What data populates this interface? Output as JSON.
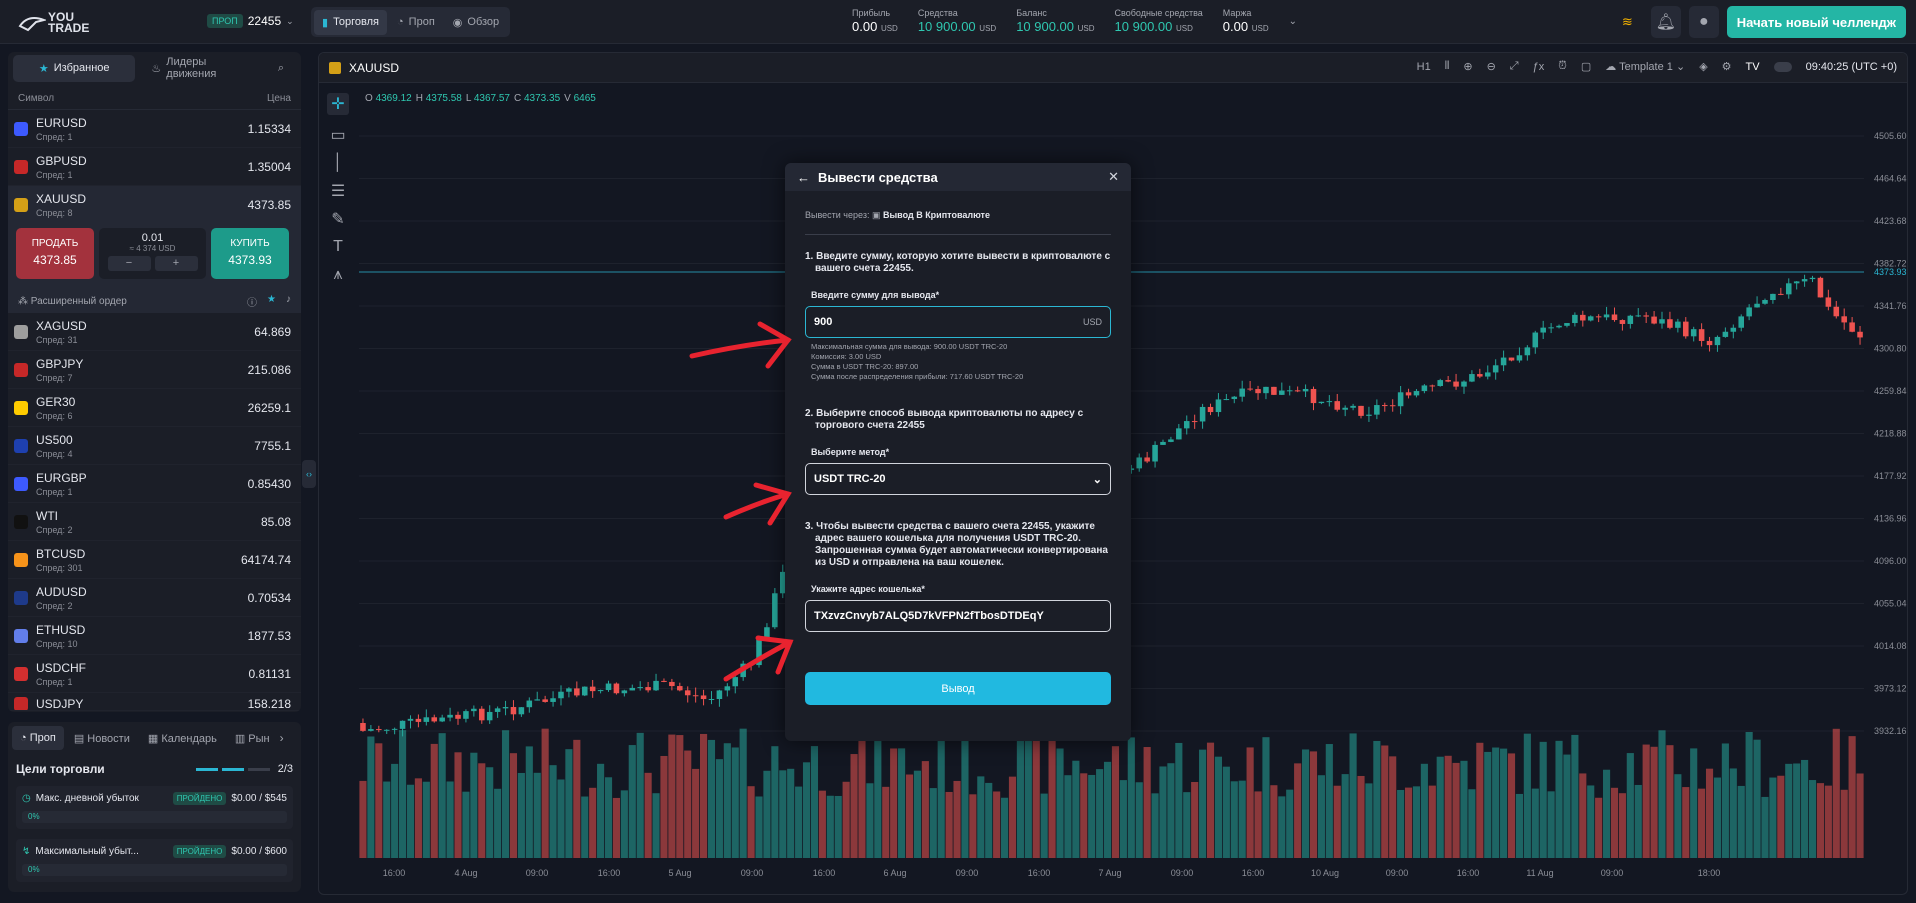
{
  "brand": {
    "line1": "YOU",
    "line2": "TRADE"
  },
  "account": {
    "badge": "ПРОП",
    "number": "22455"
  },
  "nav": [
    {
      "label": "Торговля",
      "active": true
    },
    {
      "label": "Проп"
    },
    {
      "label": "Обзор"
    }
  ],
  "stats": [
    {
      "label": "Прибыль",
      "value": "0.00",
      "unit": "USD"
    },
    {
      "label": "Средства",
      "value": "10 900.00",
      "unit": "USD"
    },
    {
      "label": "Баланс",
      "value": "10 900.00",
      "unit": "USD"
    },
    {
      "label": "Свободные средства",
      "value": "10 900.00",
      "unit": "USD"
    },
    {
      "label": "Маржа",
      "value": "0.00",
      "unit": "USD"
    }
  ],
  "cta": "Начать новый челлендж",
  "watchlist": {
    "tabs": [
      "Избранное",
      "Лидеры движения"
    ],
    "col_symbol": "Символ",
    "col_price": "Цена",
    "rows": [
      {
        "name": "EURUSD",
        "spread": "Спред: 1",
        "price": "1.15334",
        "color": "#3d5afe"
      },
      {
        "name": "GBPUSD",
        "spread": "Спред: 1",
        "price": "1.35004",
        "color": "#c62828"
      },
      {
        "name": "XAUUSD",
        "spread": "Спред: 8",
        "price": "4373.85",
        "color": "#d4a017"
      },
      {
        "name": "XAGUSD",
        "spread": "Спред: 31",
        "price": "64.869",
        "color": "#9e9e9e"
      },
      {
        "name": "GBPJPY",
        "spread": "Спред: 7",
        "price": "215.086",
        "color": "#c62828"
      },
      {
        "name": "GER30",
        "spread": "Спред: 6",
        "price": "26259.1",
        "color": "#ffcc00"
      },
      {
        "name": "US500",
        "spread": "Спред: 4",
        "price": "7755.1",
        "color": "#1e40af"
      },
      {
        "name": "EURGBP",
        "spread": "Спред: 1",
        "price": "0.85430",
        "color": "#3d5afe"
      },
      {
        "name": "WTI",
        "spread": "Спред: 2",
        "price": "85.08",
        "color": "#111111"
      },
      {
        "name": "BTCUSD",
        "spread": "Спред: 301",
        "price": "64174.74",
        "color": "#f7931a"
      },
      {
        "name": "AUDUSD",
        "spread": "Спред: 2",
        "price": "0.70534",
        "color": "#1e3a8a"
      },
      {
        "name": "ETHUSD",
        "spread": "Спред: 10",
        "price": "1877.53",
        "color": "#627eea"
      },
      {
        "name": "USDCHF",
        "spread": "Спред: 1",
        "price": "0.81131",
        "color": "#d32f2f"
      }
    ],
    "partial_row": {
      "name": "USDJPY",
      "price": "158.218"
    },
    "trade": {
      "sell_label": "ПРОДАТЬ",
      "sell_price": "4373.85",
      "lot": "0.01",
      "lot_usd": "≈ 4 374 USD",
      "buy_label": "КУПИТЬ",
      "buy_price": "4373.93"
    },
    "advanced": "Расширенный ордер"
  },
  "bottom": {
    "tabs": [
      "Проп",
      "Новости",
      "Календарь",
      "Рын"
    ],
    "goals_title": "Цели торговли",
    "goals_count": "2/3",
    "goals": [
      {
        "label": "Макс. дневной убыток",
        "status": "ПРОЙДЕНО",
        "value": "$0.00 / $545",
        "pct": "0%"
      },
      {
        "label": "Максимальный убыт...",
        "status": "ПРОЙДЕНО",
        "value": "$0.00 / $600",
        "pct": "0%"
      }
    ]
  },
  "chart": {
    "symbol": "XAUUSD",
    "timeframe": "H1",
    "template": "Template 1",
    "time": "09:40:25 (UTC +0)",
    "ohlc": {
      "o": "4369.12",
      "h": "4375.58",
      "l": "4367.57",
      "c": "4373.35",
      "v": "6465"
    },
    "y_ticks": [
      "4505.60",
      "4464.64",
      "4423.68",
      "4382.72",
      "4341.76",
      "4300.80",
      "4259.84",
      "4218.88",
      "4177.92",
      "4136.96",
      "4096.00",
      "4055.04",
      "4014.08",
      "3973.12",
      "3932.16"
    ],
    "current_price": "4373.93",
    "x_ticks": [
      "16:00",
      "4 Aug",
      "09:00",
      "16:00",
      "5 Aug",
      "09:00",
      "16:00",
      "6 Aug",
      "09:00",
      "16:00",
      "7 Aug",
      "09:00",
      "16:00",
      "10 Aug",
      "09:00",
      "16:00",
      "11 Aug",
      "09:00",
      "18:00"
    ]
  },
  "modal": {
    "title": "Вывести средства",
    "via_label": "Вывести через:",
    "via_value": "Вывод В Криптовалюте",
    "step1": "1. Введите сумму, которую хотите вывести в криптовалюте с вашего счета 22455.",
    "amount_label": "Введите сумму для вывода*",
    "amount_value": "900",
    "amount_unit": "USD",
    "info": [
      "Максимальная сумма для вывода: 900.00 USDT TRC-20",
      "Комиссия: 3.00 USD",
      "Сумма в USDT TRC-20: 897.00",
      "Сумма после распределения прибыли: 717.60 USDT TRC-20"
    ],
    "step2": "2. Выберите способ вывода криптовалюты по адресу с торгового счета 22455",
    "method_label": "Выберите метод*",
    "method_value": "USDT TRC-20",
    "step3": "3. Чтобы вывести средства с вашего счета 22455, укажите адрес вашего кошелька для получения USDT TRC-20. Запрошенная сумма будет автоматически конвертирована из USD и отправлена на ваш кошелек.",
    "wallet_label": "Укажите адрес кошелька*",
    "wallet_value": "TXzvzCnvyb7ALQ5D7kVFPN2fTbosDTDEqY",
    "submit": "Вывод"
  },
  "colors": {
    "up": "#26a69a",
    "down": "#ef5350",
    "accent": "#21b9e0",
    "brand": "#24b6a5"
  }
}
